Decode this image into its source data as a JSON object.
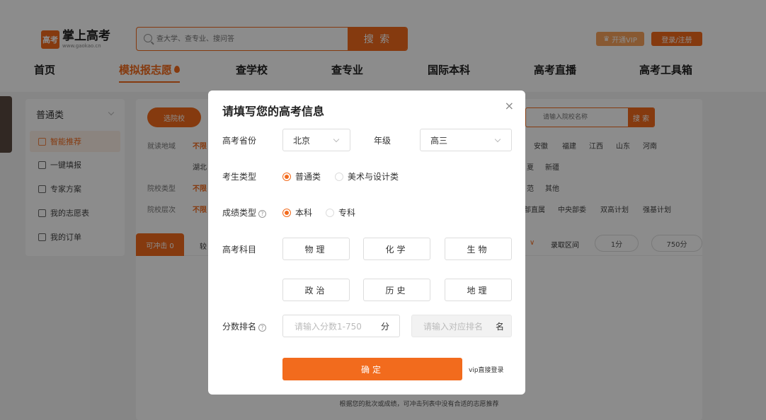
{
  "brand": {
    "logo_cn": "掌上高考",
    "logo_en": "www.gaokao.cn",
    "logo_mark": "高考"
  },
  "search": {
    "placeholder": "查大学、查专业、搜问答",
    "button": "搜 索"
  },
  "account": {
    "vip": "开通VIP",
    "login": "登录/注册"
  },
  "nav": [
    "首页",
    "模拟报志愿",
    "查学校",
    "查专业",
    "国际本科",
    "高考直播",
    "高考工具箱"
  ],
  "sidebar": {
    "type": "普通类",
    "items": [
      "智能推荐",
      "一键填报",
      "专家方案",
      "我的志愿表",
      "我的订单"
    ]
  },
  "filters": {
    "button": "选院校",
    "region_label": "就读地域",
    "region_default": "不限",
    "region_more": "湖北",
    "type_label": "院校类型",
    "type_default": "不限",
    "level_label": "院校层次",
    "level_default": "不限",
    "provinces": [
      "安徽",
      "福建",
      "江西",
      "山东",
      "河南"
    ],
    "provinces2": [
      "夏",
      "新疆"
    ],
    "types": [
      "范",
      "其他"
    ],
    "levels": [
      "部直属",
      "中央部委",
      "双高计划",
      "强基计划"
    ],
    "school_search_placeholder": "请输入院校名称",
    "school_search_button": "搜 索"
  },
  "tabs": {
    "active": "可冲击 0",
    "next": "较"
  },
  "range": {
    "label": "录取区间",
    "min": "1分",
    "max": "750分"
  },
  "footer_hint": "根据您的批次或成绩，可冲击列表中没有合适的志愿推荐",
  "modal": {
    "title": "请填写您的高考信息",
    "close": "×",
    "province_label": "高考省份",
    "province_value": "北京",
    "grade_label": "年级",
    "grade_value": "高三",
    "student_type_label": "考生类型",
    "student_types": [
      "普通类",
      "美术与设计类"
    ],
    "score_type_label": "成绩类型",
    "score_types": [
      "本科",
      "专科"
    ],
    "subjects_label": "高考科目",
    "subjects": [
      "物理",
      "化学",
      "生物",
      "政治",
      "历史",
      "地理"
    ],
    "rank_label": "分数排名",
    "score_placeholder": "请输入分数1-750",
    "score_unit": "分",
    "rank_placeholder": "请输入对应排名",
    "rank_unit": "名",
    "confirm": "确定",
    "vip_login": "vip直接登录"
  },
  "colors": {
    "accent": "#f26b1d",
    "overlay": "rgba(0,0,0,0.45)"
  }
}
